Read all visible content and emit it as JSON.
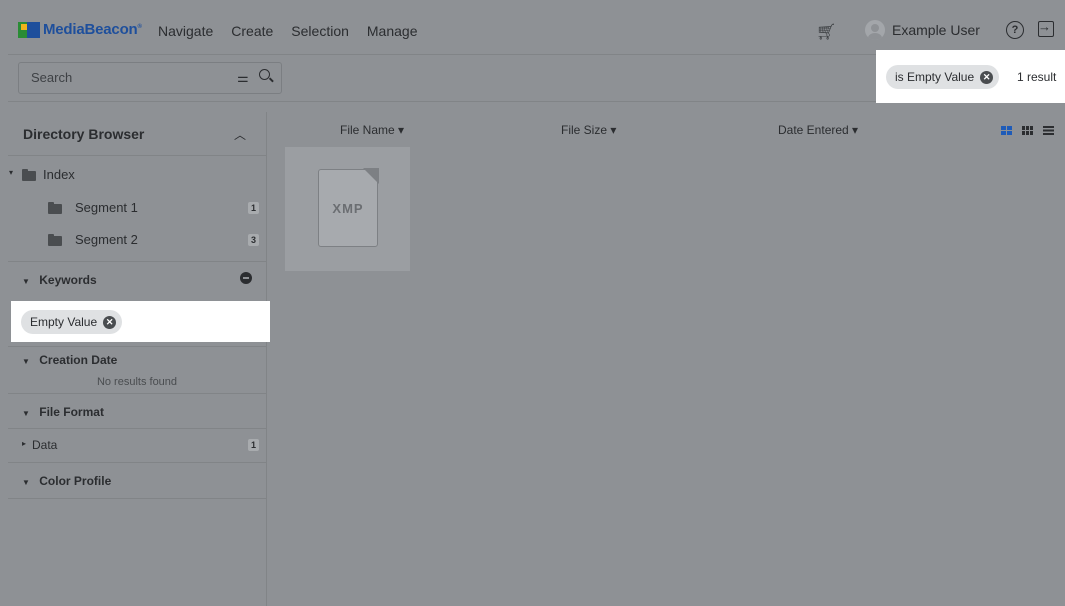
{
  "app": {
    "logo_text": "MediaBeacon"
  },
  "nav": [
    "Navigate",
    "Create",
    "Selection",
    "Manage"
  ],
  "user": {
    "name": "Example User"
  },
  "icons": {
    "cart": "cart-icon",
    "help": "help-icon",
    "logout": "logout-icon",
    "search": "search-icon",
    "filter": "filter-icon"
  },
  "search": {
    "placeholder": "Search"
  },
  "results": {
    "chip_label": "is Empty Value",
    "count": "1 result"
  },
  "sidebar": {
    "title": "Directory Browser",
    "tree": [
      {
        "label": "Index"
      },
      {
        "label": "Segment 1",
        "count": "1"
      },
      {
        "label": "Segment 2",
        "count": "3"
      }
    ],
    "keywords": {
      "label": "Keywords",
      "chip_label": "Empty Value"
    },
    "creation_date": {
      "label": "Creation Date",
      "note": "No results found"
    },
    "file_format": {
      "label": "File Format",
      "item": "Data",
      "count": "1"
    },
    "color_profile": {
      "label": "Color Profile"
    }
  },
  "columns": [
    "File Name",
    "File Size",
    "Date Entered"
  ],
  "file": {
    "thumb_label": "XMP"
  },
  "colors": {
    "accent": "#1e5bb8",
    "highlight": "#ffffff",
    "overlay": "#8e9195"
  }
}
